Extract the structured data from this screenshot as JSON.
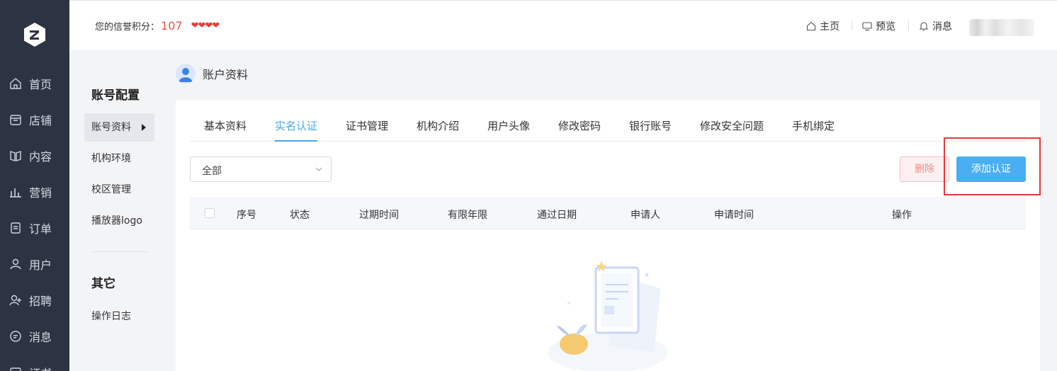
{
  "leftnav": {
    "items": [
      {
        "label": "首页",
        "icon": "home-icon"
      },
      {
        "label": "店铺",
        "icon": "shop-icon"
      },
      {
        "label": "内容",
        "icon": "book-icon"
      },
      {
        "label": "营销",
        "icon": "bar-chart-icon"
      },
      {
        "label": "订单",
        "icon": "document-icon"
      },
      {
        "label": "用户",
        "icon": "user-icon"
      },
      {
        "label": "招聘",
        "icon": "recruit-icon"
      },
      {
        "label": "消息",
        "icon": "chat-icon"
      },
      {
        "label": "证书",
        "icon": "certificate-icon"
      }
    ]
  },
  "header": {
    "credit_label": "您的信誉积分：",
    "credit_score": "107",
    "hearts": "❤❤❤❤",
    "links": {
      "home": "主页",
      "preview": "预览",
      "messages": "消息"
    }
  },
  "subnav": {
    "group1_title": "账号配置",
    "group1_items": [
      "账号资料",
      "机构环境",
      "校区管理",
      "播放器logo"
    ],
    "group2_title": "其它",
    "group2_items": [
      "操作日志"
    ]
  },
  "page": {
    "title": "账户资料"
  },
  "tabs": [
    "基本资料",
    "实名认证",
    "证书管理",
    "机构介绍",
    "用户头像",
    "修改密码",
    "银行账号",
    "修改安全问题",
    "手机绑定"
  ],
  "active_tab": "实名认证",
  "filter": {
    "selected": "全部"
  },
  "buttons": {
    "delete": "删除",
    "add": "添加认证"
  },
  "table": {
    "headers": [
      "序号",
      "状态",
      "过期时间",
      "有限年限",
      "通过日期",
      "申请人",
      "申请时间",
      "操作"
    ],
    "rows": []
  },
  "colors": {
    "nav_bg": "#2c3444",
    "accent": "#4aa7e8",
    "primary_button": "#4aaef2",
    "danger_text": "#f08a8a",
    "highlight": "#e33a3a",
    "score": "#e25a4a"
  }
}
